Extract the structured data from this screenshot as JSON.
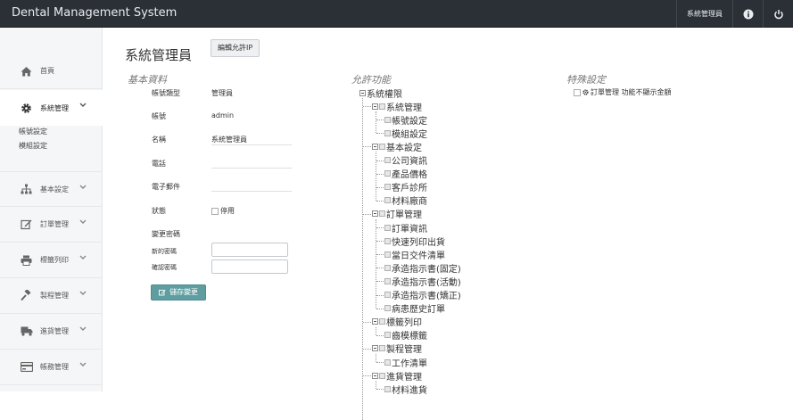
{
  "header": {
    "brand": "Dental Management System",
    "user": "系統管理員",
    "icons": [
      "info-icon",
      "power-icon"
    ]
  },
  "sidebar": {
    "items": [
      {
        "name": "home",
        "label": "首頁",
        "icon": "home-icon"
      },
      {
        "name": "system",
        "label": "系統管理",
        "icon": "gear-icon",
        "active": true
      },
      {
        "name": "basic",
        "label": "基本設定",
        "icon": "sitemap-icon"
      },
      {
        "name": "order",
        "label": "訂單管理",
        "icon": "edit-icon"
      },
      {
        "name": "label",
        "label": "標籤列印",
        "icon": "print-icon"
      },
      {
        "name": "process",
        "label": "製程管理",
        "icon": "gavel-icon"
      },
      {
        "name": "purchase",
        "label": "進貨管理",
        "icon": "truck-icon"
      },
      {
        "name": "account",
        "label": "帳務管理",
        "icon": "card-icon"
      }
    ],
    "sub_items": [
      "帳號設定",
      "模組設定"
    ]
  },
  "main": {
    "title": "系統管理員",
    "ip_button": "編輯允許IP",
    "basic": {
      "title": "基本資料",
      "type_label": "帳號類型",
      "type_value": "管理員",
      "account_label": "帳號",
      "account_value": "admin",
      "name_label": "名稱",
      "name_value": "系統管理員",
      "phone_label": "電話",
      "email_label": "電子郵件",
      "status_label": "狀態",
      "status_checkbox": "停用",
      "pwd_section": "變更密碼",
      "new_pwd_label": "新的密碼",
      "confirm_pwd_label": "確認密碼",
      "save_button": "儲存變更"
    },
    "permissions": {
      "title": "允許功能",
      "root": "系統權限",
      "groups": [
        {
          "label": "系統管理",
          "children": [
            "帳號設定",
            "模組設定"
          ]
        },
        {
          "label": "基本設定",
          "children": [
            "公司資訊",
            "產品價格",
            "客戶診所",
            "材料廠商"
          ]
        },
        {
          "label": "訂單管理",
          "children": [
            "訂單資訊",
            "快速列印出貨",
            "當日交件清單",
            "承造指示書(固定)",
            "承造指示書(活動)",
            "承造指示書(矯正)",
            "病患歷史訂單"
          ]
        },
        {
          "label": "標籤列印",
          "children": [
            "齒模標籤"
          ]
        },
        {
          "label": "製程管理",
          "children": [
            "工作清單"
          ]
        },
        {
          "label": "進貨管理",
          "children": [
            "材料進貨"
          ]
        }
      ]
    },
    "special": {
      "title": "特殊設定",
      "item": "訂單管理 功能不顯示金額"
    }
  }
}
